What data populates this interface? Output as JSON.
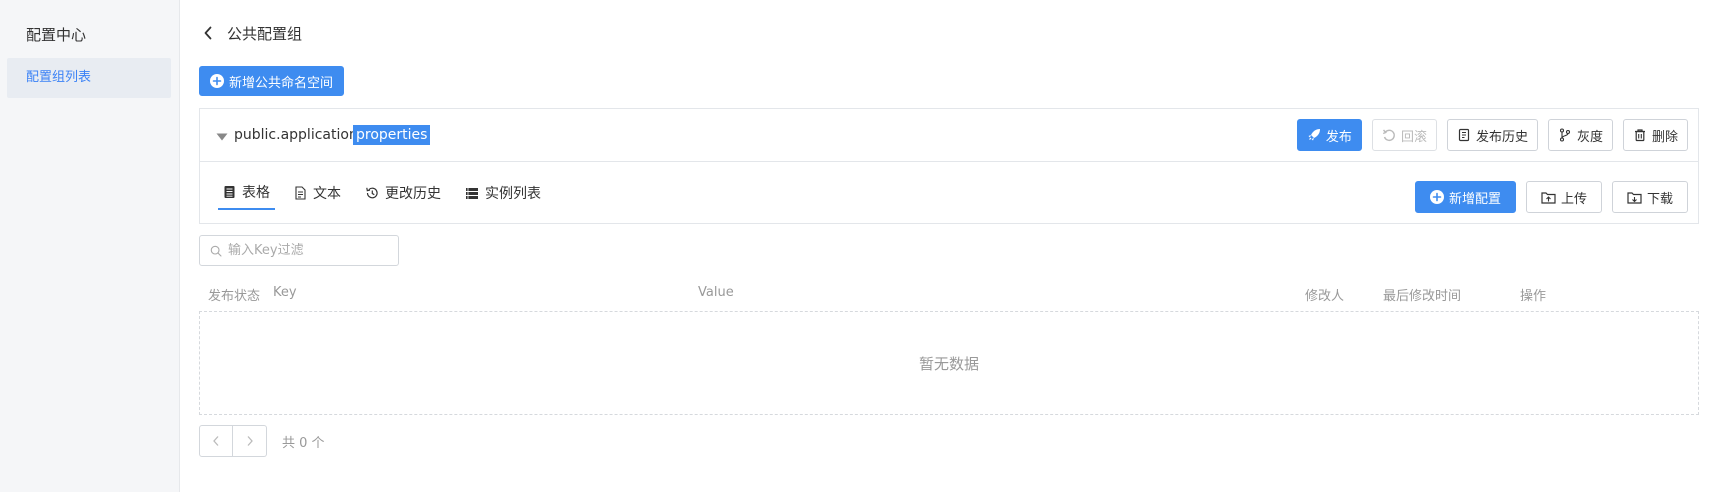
{
  "sidebar": {
    "title": "配置中心",
    "items": [
      {
        "label": "配置组列表",
        "active": true
      }
    ]
  },
  "header": {
    "title": "公共配置组"
  },
  "toolbar": {
    "add_namespace_label": "新增公共命名空间"
  },
  "namespace": {
    "name": "public.application",
    "format": "properties",
    "actions": {
      "publish": "发布",
      "rollback": "回滚",
      "history": "发布历史",
      "gray": "灰度",
      "delete": "删除"
    }
  },
  "tabs": [
    {
      "label": "表格",
      "icon": "table-icon",
      "active": true
    },
    {
      "label": "文本",
      "icon": "file-text-icon"
    },
    {
      "label": "更改历史",
      "icon": "history-icon"
    },
    {
      "label": "实例列表",
      "icon": "instance-list-icon"
    }
  ],
  "tab_actions": {
    "add_config": "新增配置",
    "upload": "上传",
    "download": "下载"
  },
  "search": {
    "placeholder": "输入Key过滤",
    "value": ""
  },
  "table": {
    "columns": [
      "发布状态",
      "Key",
      "Value",
      "修改人",
      "最后修改时间",
      "操作"
    ],
    "rows": [],
    "empty_text": "暂无数据"
  },
  "pagination": {
    "total_text": "共 0 个"
  },
  "colors": {
    "primary": "#3e8cf0",
    "sidebar_bg": "#f5f6f8",
    "active_item_bg": "#e8ecf2"
  }
}
